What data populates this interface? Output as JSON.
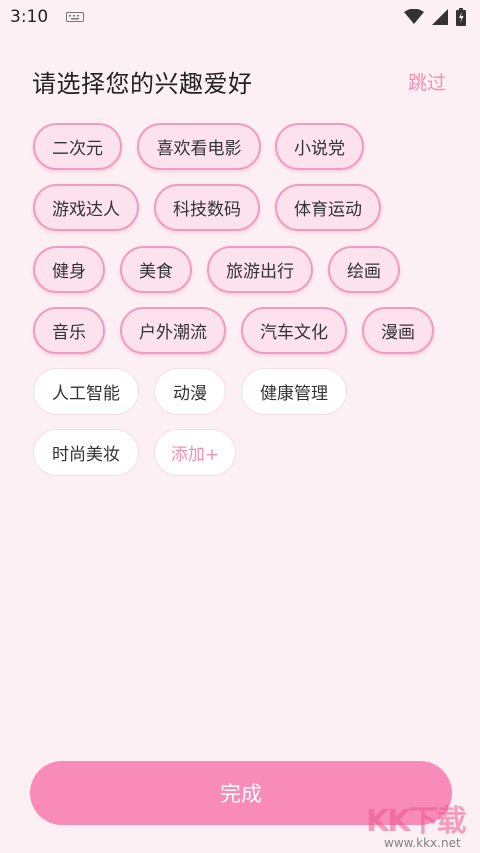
{
  "status_bar": {
    "time": "3:10"
  },
  "header": {
    "title": "请选择您的兴趣爱好",
    "skip_label": "跳过"
  },
  "tags": [
    {
      "label": "二次元",
      "selected": true
    },
    {
      "label": "喜欢看电影",
      "selected": true
    },
    {
      "label": "小说党",
      "selected": true
    },
    {
      "label": "游戏达人",
      "selected": true
    },
    {
      "label": "科技数码",
      "selected": true
    },
    {
      "label": "体育运动",
      "selected": true
    },
    {
      "label": "健身",
      "selected": true
    },
    {
      "label": "美食",
      "selected": true
    },
    {
      "label": "旅游出行",
      "selected": true
    },
    {
      "label": "绘画",
      "selected": true
    },
    {
      "label": "音乐",
      "selected": true
    },
    {
      "label": "户外潮流",
      "selected": true
    },
    {
      "label": "汽车文化",
      "selected": true
    },
    {
      "label": "漫画",
      "selected": true
    },
    {
      "label": "人工智能",
      "selected": false
    },
    {
      "label": "动漫",
      "selected": false
    },
    {
      "label": "健康管理",
      "selected": false
    },
    {
      "label": "时尚美妆",
      "selected": false
    }
  ],
  "add_tag_label": "添加+",
  "footer": {
    "done_label": "完成"
  },
  "watermark": {
    "logo_text": "KK下载",
    "url": "www.kkx.net"
  },
  "colors": {
    "accent": "#f98bb8",
    "accent_text": "#f38fb5",
    "selected_bg": "#fbe2ec",
    "selected_border": "#f09cc0",
    "page_bg": "#fdf0f4"
  }
}
